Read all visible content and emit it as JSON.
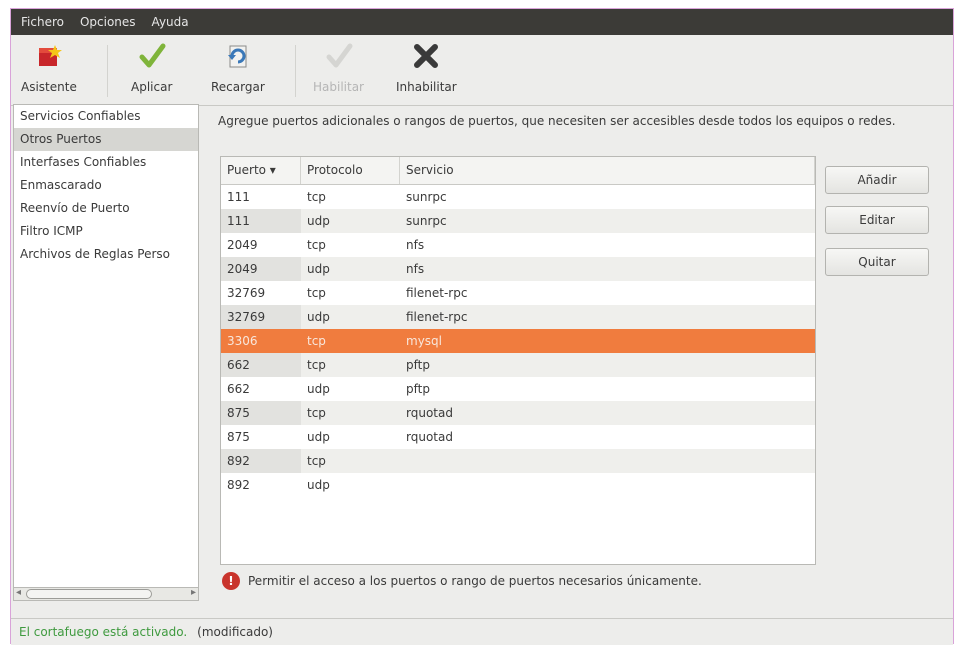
{
  "menu": [
    "Fichero",
    "Opciones",
    "Ayuda"
  ],
  "toolbar": {
    "asistente": "Asistente",
    "aplicar": "Aplicar",
    "recargar": "Recargar",
    "habilitar": "Habilitar",
    "inhabilitar": "Inhabilitar"
  },
  "sidebar": {
    "items": [
      "Servicios Confiables",
      "Otros Puertos",
      "Interfases Confiables",
      "Enmascarado",
      "Reenvío de Puerto",
      "Filtro ICMP",
      "Archivos de Reglas Perso"
    ],
    "selected_index": 1
  },
  "description": "Agregue puertos adicionales o rangos de puertos, que necesiten ser accesibles desde todos los equipos o redes.",
  "table": {
    "headers": [
      "Puerto ▾",
      "Protocolo",
      "Servicio"
    ],
    "rows": [
      [
        "111",
        "tcp",
        "sunrpc"
      ],
      [
        "111",
        "udp",
        "sunrpc"
      ],
      [
        "2049",
        "tcp",
        "nfs"
      ],
      [
        "2049",
        "udp",
        "nfs"
      ],
      [
        "32769",
        "tcp",
        "filenet-rpc"
      ],
      [
        "32769",
        "udp",
        "filenet-rpc"
      ],
      [
        "3306",
        "tcp",
        "mysql"
      ],
      [
        "662",
        "tcp",
        "pftp"
      ],
      [
        "662",
        "udp",
        "pftp"
      ],
      [
        "875",
        "tcp",
        "rquotad"
      ],
      [
        "875",
        "udp",
        "rquotad"
      ],
      [
        "892",
        "tcp",
        ""
      ],
      [
        "892",
        "udp",
        ""
      ]
    ],
    "selected_row": 6
  },
  "buttons": {
    "add": "Añadir",
    "edit": "Editar",
    "remove": "Quitar"
  },
  "notice": "Permitir el acceso a los puertos o rango de puertos necesarios únicamente.",
  "status": {
    "main": "El cortafuego está activado.",
    "modified": "(modificado)"
  },
  "colors": {
    "selection": "#f07c3e",
    "status_ok": "#3f9a3f",
    "menubar": "#3c3b37"
  }
}
